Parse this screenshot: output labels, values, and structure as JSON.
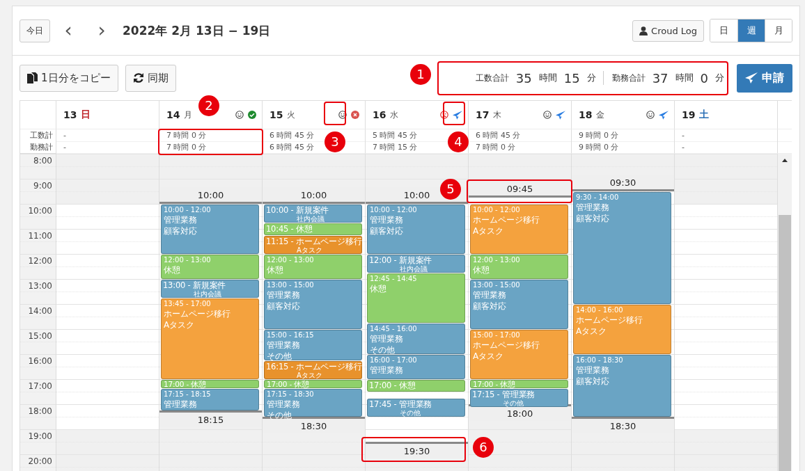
{
  "toolbar": {
    "today": "今日",
    "prev": "‹",
    "next": "›",
    "title": "2022年 2月 13日 − 19日",
    "user_button": "Croud Log",
    "views": [
      {
        "label": "日",
        "selected": false
      },
      {
        "label": "週",
        "selected": true
      },
      {
        "label": "月",
        "selected": false
      }
    ]
  },
  "actions": {
    "copy": "1日分をコピー",
    "sync": "同期",
    "totals": [
      {
        "label": "工数合計",
        "hours": "35",
        "hours_unit": "時間",
        "minutes": "15",
        "minutes_unit": "分"
      },
      {
        "label": "勤務合計",
        "hours": "37",
        "hours_unit": "時間",
        "minutes": "0",
        "minutes_unit": "分"
      }
    ],
    "apply": "申請"
  },
  "row_labels": [
    "工数計",
    "勤務計"
  ],
  "hours": [
    "8:00",
    "9:00",
    "10:00",
    "11:00",
    "12:00",
    "13:00",
    "14:00",
    "15:00",
    "16:00",
    "17:00",
    "18:00",
    "19:00",
    "20:00"
  ],
  "days": [
    {
      "date": "13",
      "weekday": "日",
      "color": "#c0282d",
      "work": "-",
      "duty": "-"
    },
    {
      "date": "14",
      "weekday": "月",
      "icons": [
        {
          "kind": "smile"
        },
        {
          "kind": "approved"
        }
      ],
      "work": "7 時間 0 分",
      "duty": "7 時間 0 分",
      "start": "10:00",
      "end": "18:15",
      "events": [
        {
          "kind": "full",
          "color": "#6aa4c4",
          "time": "10:00 - 12:00",
          "lines": [
            "管理業務",
            "顧客対応"
          ]
        },
        {
          "kind": "full",
          "color": "#8fd06b",
          "time": "12:00 - 13:00",
          "lines": [
            "休憩"
          ]
        },
        {
          "kind": "compact",
          "color": "#6aa4c4",
          "time": "13:00 - 新規案件",
          "lines": [
            "社内会議"
          ]
        },
        {
          "kind": "full",
          "color": "#f4a23e",
          "time": "13:45 - 17:00",
          "lines": [
            "ホームページ移行",
            "Aタスク"
          ]
        },
        {
          "kind": "compact",
          "color": "#8fd06b",
          "time": "17:00 - 休憩"
        },
        {
          "kind": "full",
          "color": "#6aa4c4",
          "time": "17:15 - 18:15",
          "lines": [
            "管理業務"
          ]
        }
      ]
    },
    {
      "date": "15",
      "weekday": "火",
      "icons": [
        {
          "kind": "smile"
        },
        {
          "kind": "rejected"
        }
      ],
      "work": "6 時間 45 分",
      "duty": "6 時間 45 分",
      "start": "10:00",
      "end": "18:30",
      "events": [
        {
          "kind": "compact",
          "color": "#6aa4c4",
          "time": "10:00 - 新規案件",
          "lines": [
            "社内会議"
          ]
        },
        {
          "kind": "compact",
          "color": "#8fd06b",
          "time": "10:45 - 休憩"
        },
        {
          "kind": "compact",
          "color": "#e8922c",
          "time": "11:15 - ホームページ移行",
          "lines": [
            "Aタスク"
          ]
        },
        {
          "kind": "full",
          "color": "#8fd06b",
          "time": "12:00 - 13:00",
          "lines": [
            "休憩"
          ]
        },
        {
          "kind": "full",
          "color": "#6aa4c4",
          "time": "13:00 - 15:00",
          "lines": [
            "管理業務",
            "顧客対応"
          ]
        },
        {
          "kind": "full",
          "color": "#6aa4c4",
          "time": "15:00 - 16:15",
          "lines": [
            "管理業務",
            "その他"
          ]
        },
        {
          "kind": "compact",
          "color": "#e8922c",
          "time": "16:15 - ホームページ移行",
          "lines": [
            "Aタスク"
          ]
        },
        {
          "kind": "compact",
          "color": "#8fd06b",
          "time": "17:00 - 休憩"
        },
        {
          "kind": "full",
          "color": "#6aa4c4",
          "time": "17:15 - 18:30",
          "lines": [
            "管理業務",
            "その他"
          ]
        }
      ]
    },
    {
      "date": "16",
      "weekday": "水",
      "icons": [
        {
          "kind": "frown"
        },
        {
          "kind": "submitted"
        }
      ],
      "work": "5 時間 45 分",
      "duty": "7 時間 15 分",
      "start": "10:00",
      "end": "19:30",
      "events": [
        {
          "kind": "full",
          "color": "#6aa4c4",
          "time": "10:00 - 12:00",
          "lines": [
            "管理業務",
            "顧客対応"
          ]
        },
        {
          "kind": "compact",
          "color": "#6aa4c4",
          "time": "12:00 - 新規案件",
          "lines": [
            "社内会議"
          ]
        },
        {
          "kind": "full",
          "color": "#8fd06b",
          "time": "12:45 - 14:45",
          "lines": [
            "休憩"
          ]
        },
        {
          "kind": "full",
          "color": "#6aa4c4",
          "time": "14:45 - 16:00",
          "lines": [
            "管理業務",
            "その他"
          ]
        },
        {
          "kind": "full",
          "color": "#6aa4c4",
          "time": "16:00 - 17:00",
          "lines": [
            "管理業務"
          ]
        },
        {
          "kind": "compact",
          "color": "#8fd06b",
          "time": "17:00 - 休憩"
        },
        {
          "kind": "compact",
          "color": "#6aa4c4",
          "time": "17:45 - 管理業務",
          "lines": [
            "その他"
          ]
        }
      ]
    },
    {
      "date": "17",
      "weekday": "木",
      "icons": [
        {
          "kind": "smile"
        },
        {
          "kind": "submitted"
        }
      ],
      "work": "6 時間 45 分",
      "duty": "7 時間 0 分",
      "start": "09:45",
      "end": "18:00",
      "events": [
        {
          "kind": "full",
          "color": "#f4a23e",
          "time": "10:00 - 12:00",
          "lines": [
            "ホームページ移行",
            "Aタスク"
          ]
        },
        {
          "kind": "full",
          "color": "#8fd06b",
          "time": "12:00 - 13:00",
          "lines": [
            "休憩"
          ]
        },
        {
          "kind": "full",
          "color": "#6aa4c4",
          "time": "13:00 - 15:00",
          "lines": [
            "管理業務",
            "顧客対応"
          ]
        },
        {
          "kind": "full",
          "color": "#f4a23e",
          "time": "15:00 - 17:00",
          "lines": [
            "ホームページ移行",
            "Aタスク"
          ]
        },
        {
          "kind": "compact",
          "color": "#8fd06b",
          "time": "17:00 - 休憩"
        },
        {
          "kind": "compact",
          "color": "#6aa4c4",
          "time": "17:15 - 管理業務",
          "lines": [
            "その他"
          ]
        }
      ]
    },
    {
      "date": "18",
      "weekday": "金",
      "icons": [
        {
          "kind": "smile"
        },
        {
          "kind": "submitted"
        }
      ],
      "work": "9 時間 0 分",
      "duty": "9 時間 0 分",
      "start": "09:30",
      "end": "18:30",
      "events": [
        {
          "kind": "full",
          "color": "#6aa4c4",
          "time": "9:30 - 14:00",
          "lines": [
            "管理業務",
            "顧客対応"
          ]
        },
        {
          "kind": "full",
          "color": "#f4a23e",
          "time": "14:00 - 16:00",
          "lines": [
            "ホームページ移行",
            "Aタスク"
          ]
        },
        {
          "kind": "full",
          "color": "#6aa4c4",
          "time": "16:00 - 18:30",
          "lines": [
            "管理業務",
            "顧客対応"
          ]
        }
      ]
    },
    {
      "date": "19",
      "weekday": "土",
      "color": "#2a6fb5",
      "work": "-",
      "duty": "-"
    }
  ],
  "callouts": [
    "1",
    "2",
    "3",
    "4",
    "5",
    "6"
  ]
}
